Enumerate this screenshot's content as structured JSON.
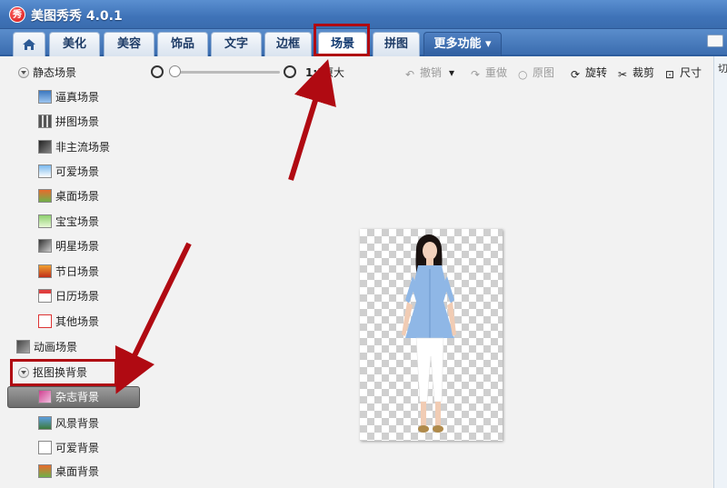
{
  "window": {
    "title": "美图秀秀 4.0.1",
    "logo_text": "秀"
  },
  "tabs": [
    {
      "label": "",
      "icon": "home-icon"
    },
    {
      "label": "美化"
    },
    {
      "label": "美容"
    },
    {
      "label": "饰品"
    },
    {
      "label": "文字"
    },
    {
      "label": "边框"
    },
    {
      "label": "场景",
      "active": true
    },
    {
      "label": "拼图"
    },
    {
      "label": "更多功能 ▾"
    }
  ],
  "sidebar": {
    "groups": [
      {
        "label": "静态场景",
        "expanded": true,
        "items": [
          "逼真场景",
          "拼图场景",
          "非主流场景",
          "可爱场景",
          "桌面场景",
          "宝宝场景",
          "明星场景",
          "节日场景",
          "日历场景",
          "其他场景"
        ]
      },
      {
        "label": "动画场景",
        "expanded": false,
        "items": []
      },
      {
        "label": "抠图换背景",
        "expanded": true,
        "items": [
          "杂志背景",
          "风景背景",
          "可爱背景",
          "桌面背景"
        ],
        "selected": "杂志背景"
      }
    ]
  },
  "toolbar": {
    "ratio_label": "1:1",
    "original_size": "原大",
    "undo": "撤销",
    "redo": "重做",
    "original_image": "原图",
    "rotate": "旋转",
    "crop": "裁剪",
    "size": "尺寸",
    "zoom_level": 0
  },
  "right_panel": {
    "label": "切"
  },
  "colors": {
    "accent": "#3f73b8",
    "highlight": "#b00a12",
    "selected": "#7a7a7a"
  }
}
